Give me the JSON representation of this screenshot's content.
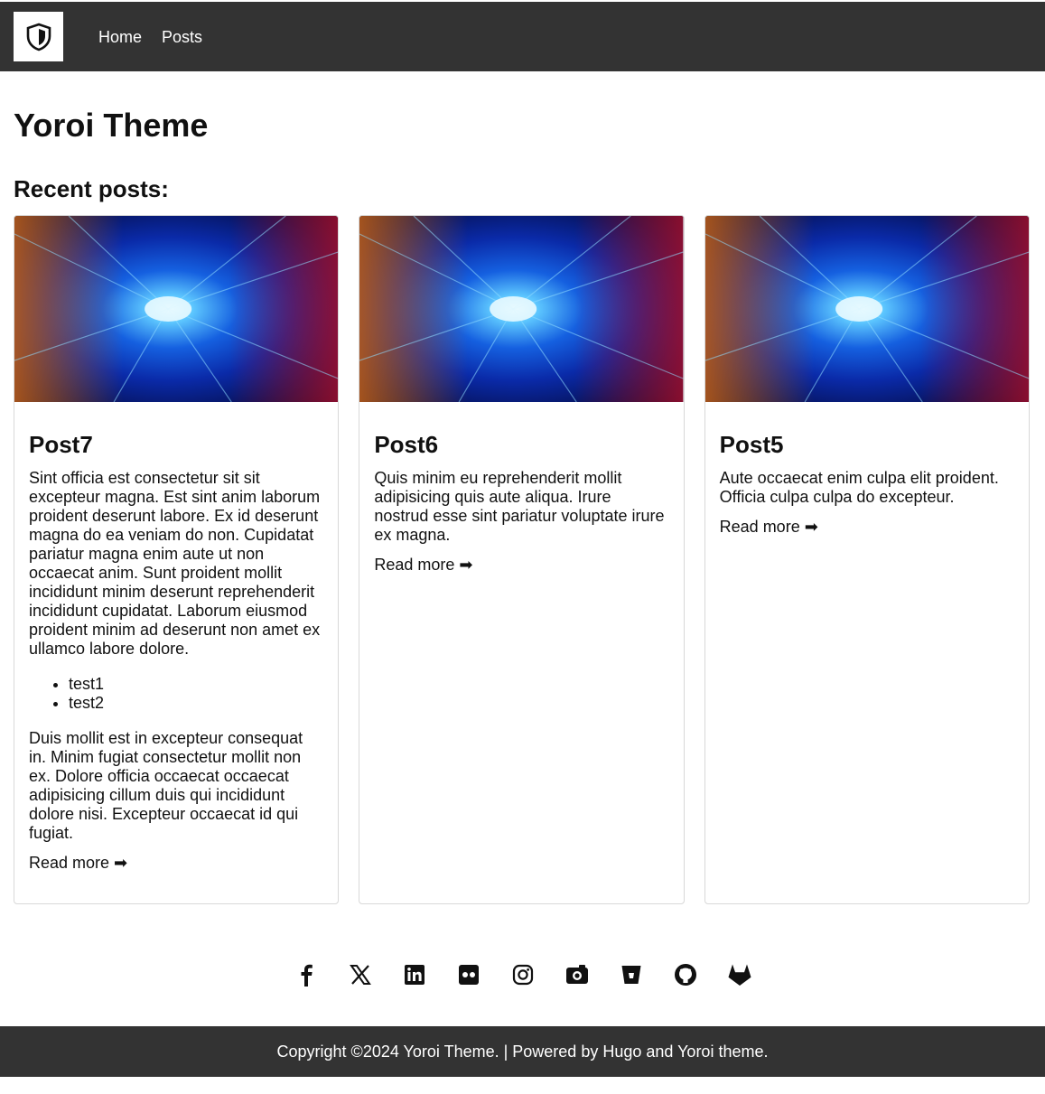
{
  "header": {
    "logo": "shield-icon",
    "nav": [
      {
        "label": "Home"
      },
      {
        "label": "Posts"
      }
    ]
  },
  "main": {
    "title": "Yoroi Theme",
    "section_title": "Recent posts:"
  },
  "posts": [
    {
      "title": "Post7",
      "paragraphs": [
        "Sint officia est consectetur sit sit excepteur magna. Est sint anim laborum proident deserunt labore. Ex id deserunt magna do ea veniam do non. Cupidatat pariatur magna enim aute ut non occaecat anim. Sunt proident mollit incididunt minim deserunt reprehenderit incididunt cupidatat. Laborum eiusmod proident minim ad deserunt non amet ex ullamco labore dolore.",
        "Duis mollit est in excepteur consequat in. Minim fugiat consectetur mollit non ex. Dolore officia occaecat occaecat adipisicing cillum duis qui incididunt dolore nisi. Excepteur occaecat id qui fugiat."
      ],
      "list": [
        "test1",
        "test2"
      ],
      "read_more": "Read more ➡"
    },
    {
      "title": "Post6",
      "paragraphs": [
        "Quis minim eu reprehenderit mollit adipisicing quis aute aliqua. Irure nostrud esse sint pariatur voluptate irure ex magna."
      ],
      "read_more": "Read more ➡"
    },
    {
      "title": "Post5",
      "paragraphs": [
        "Aute occaecat enim culpa elit proident. Officia culpa culpa do excepteur."
      ],
      "read_more": "Read more ➡"
    }
  ],
  "socials": [
    "facebook-icon",
    "x-icon",
    "linkedin-icon",
    "flickr-icon",
    "instagram-icon",
    "camera-icon",
    "bitbucket-icon",
    "github-icon",
    "gitlab-icon"
  ],
  "footer": {
    "text": "Copyright ©2024 Yoroi Theme. | Powered by Hugo and Yoroi theme."
  },
  "colors": {
    "header_bg": "#333333",
    "footer_bg": "#333333",
    "card_border": "#d8d8d8"
  }
}
